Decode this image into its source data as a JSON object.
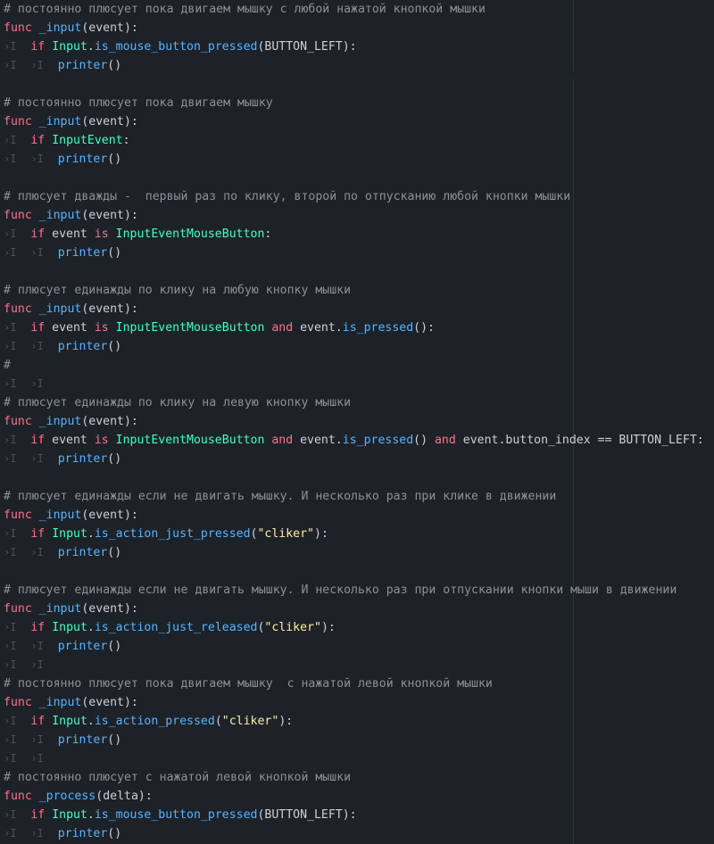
{
  "colors": {
    "background": "#1d2229",
    "comment": "#8c9097",
    "keyword": "#ff7085",
    "function": "#57b3ff",
    "type": "#42ffc2",
    "string": "#ffeda1",
    "text": "#cdcfd2",
    "tab_marker": "#4b5058"
  },
  "icons": {
    "tab_marker": "tab-indent-icon"
  },
  "lines": [
    [
      {
        "c": "cm",
        "t": "# постоянно плюсует пока двигаем мышку с любой нажатой кнопкой мышки"
      }
    ],
    [
      {
        "c": "kw",
        "t": "func"
      },
      {
        "c": "tx",
        "t": " "
      },
      {
        "c": "fn",
        "t": "_input"
      },
      {
        "c": "tx",
        "t": "(event):"
      }
    ],
    [
      {
        "c": "tab",
        "t": "›I"
      },
      {
        "c": "tx",
        "t": "  "
      },
      {
        "c": "kw",
        "t": "if"
      },
      {
        "c": "tx",
        "t": " "
      },
      {
        "c": "ty",
        "t": "Input"
      },
      {
        "c": "tx",
        "t": "."
      },
      {
        "c": "fn",
        "t": "is_mouse_button_pressed"
      },
      {
        "c": "tx",
        "t": "(BUTTON_LEFT):"
      }
    ],
    [
      {
        "c": "tab",
        "t": "›I"
      },
      {
        "c": "tx",
        "t": "  "
      },
      {
        "c": "tab",
        "t": "›I"
      },
      {
        "c": "tx",
        "t": "  "
      },
      {
        "c": "fn",
        "t": "printer"
      },
      {
        "c": "tx",
        "t": "()"
      }
    ],
    [],
    [
      {
        "c": "cm",
        "t": "# постоянно плюсует пока двигаем мышку"
      }
    ],
    [
      {
        "c": "kw",
        "t": "func"
      },
      {
        "c": "tx",
        "t": " "
      },
      {
        "c": "fn",
        "t": "_input"
      },
      {
        "c": "tx",
        "t": "(event):"
      }
    ],
    [
      {
        "c": "tab",
        "t": "›I"
      },
      {
        "c": "tx",
        "t": "  "
      },
      {
        "c": "kw",
        "t": "if"
      },
      {
        "c": "tx",
        "t": " "
      },
      {
        "c": "ty",
        "t": "InputEvent"
      },
      {
        "c": "tx",
        "t": ":"
      }
    ],
    [
      {
        "c": "tab",
        "t": "›I"
      },
      {
        "c": "tx",
        "t": "  "
      },
      {
        "c": "tab",
        "t": "›I"
      },
      {
        "c": "tx",
        "t": "  "
      },
      {
        "c": "fn",
        "t": "printer"
      },
      {
        "c": "tx",
        "t": "()"
      }
    ],
    [],
    [
      {
        "c": "cm",
        "t": "# плюсует дважды -  первый раз по клику, второй по отпусканию любой кнопки мышки"
      }
    ],
    [
      {
        "c": "kw",
        "t": "func"
      },
      {
        "c": "tx",
        "t": " "
      },
      {
        "c": "fn",
        "t": "_input"
      },
      {
        "c": "tx",
        "t": "(event):"
      }
    ],
    [
      {
        "c": "tab",
        "t": "›I"
      },
      {
        "c": "tx",
        "t": "  "
      },
      {
        "c": "kw",
        "t": "if"
      },
      {
        "c": "tx",
        "t": " event "
      },
      {
        "c": "kw",
        "t": "is"
      },
      {
        "c": "tx",
        "t": " "
      },
      {
        "c": "ty",
        "t": "InputEventMouseButton"
      },
      {
        "c": "tx",
        "t": ":"
      }
    ],
    [
      {
        "c": "tab",
        "t": "›I"
      },
      {
        "c": "tx",
        "t": "  "
      },
      {
        "c": "tab",
        "t": "›I"
      },
      {
        "c": "tx",
        "t": "  "
      },
      {
        "c": "fn",
        "t": "printer"
      },
      {
        "c": "tx",
        "t": "()"
      }
    ],
    [],
    [
      {
        "c": "cm",
        "t": "# плюсует единажды по клику на любую кнопку мышки"
      }
    ],
    [
      {
        "c": "kw",
        "t": "func"
      },
      {
        "c": "tx",
        "t": " "
      },
      {
        "c": "fn",
        "t": "_input"
      },
      {
        "c": "tx",
        "t": "(event):"
      }
    ],
    [
      {
        "c": "tab",
        "t": "›I"
      },
      {
        "c": "tx",
        "t": "  "
      },
      {
        "c": "kw",
        "t": "if"
      },
      {
        "c": "tx",
        "t": " event "
      },
      {
        "c": "kw",
        "t": "is"
      },
      {
        "c": "tx",
        "t": " "
      },
      {
        "c": "ty",
        "t": "InputEventMouseButton"
      },
      {
        "c": "tx",
        "t": " "
      },
      {
        "c": "kw",
        "t": "and"
      },
      {
        "c": "tx",
        "t": " event."
      },
      {
        "c": "fn",
        "t": "is_pressed"
      },
      {
        "c": "tx",
        "t": "():"
      }
    ],
    [
      {
        "c": "tab",
        "t": "›I"
      },
      {
        "c": "tx",
        "t": "  "
      },
      {
        "c": "tab",
        "t": "›I"
      },
      {
        "c": "tx",
        "t": "  "
      },
      {
        "c": "fn",
        "t": "printer"
      },
      {
        "c": "tx",
        "t": "()"
      }
    ],
    [
      {
        "c": "cm",
        "t": "#"
      }
    ],
    [
      {
        "c": "tab",
        "t": "›I"
      },
      {
        "c": "tx",
        "t": "  "
      },
      {
        "c": "tab",
        "t": "›I"
      }
    ],
    [
      {
        "c": "cm",
        "t": "# плюсует единажды по клику на левую кнопку мышки"
      }
    ],
    [
      {
        "c": "kw",
        "t": "func"
      },
      {
        "c": "tx",
        "t": " "
      },
      {
        "c": "fn",
        "t": "_input"
      },
      {
        "c": "tx",
        "t": "(event):"
      }
    ],
    [
      {
        "c": "tab",
        "t": "›I"
      },
      {
        "c": "tx",
        "t": "  "
      },
      {
        "c": "kw",
        "t": "if"
      },
      {
        "c": "tx",
        "t": " event "
      },
      {
        "c": "kw",
        "t": "is"
      },
      {
        "c": "tx",
        "t": " "
      },
      {
        "c": "ty",
        "t": "InputEventMouseButton"
      },
      {
        "c": "tx",
        "t": " "
      },
      {
        "c": "kw",
        "t": "and"
      },
      {
        "c": "tx",
        "t": " event."
      },
      {
        "c": "fn",
        "t": "is_pressed"
      },
      {
        "c": "tx",
        "t": "() "
      },
      {
        "c": "kw",
        "t": "and"
      },
      {
        "c": "tx",
        "t": " event.button_index == BUTTON_LEFT:"
      }
    ],
    [
      {
        "c": "tab",
        "t": "›I"
      },
      {
        "c": "tx",
        "t": "  "
      },
      {
        "c": "tab",
        "t": "›I"
      },
      {
        "c": "tx",
        "t": "  "
      },
      {
        "c": "fn",
        "t": "printer"
      },
      {
        "c": "tx",
        "t": "()"
      }
    ],
    [],
    [
      {
        "c": "cm",
        "t": "# плюсует единажды если не двигать мышку. И несколько раз при клике в движении"
      }
    ],
    [
      {
        "c": "kw",
        "t": "func"
      },
      {
        "c": "tx",
        "t": " "
      },
      {
        "c": "fn",
        "t": "_input"
      },
      {
        "c": "tx",
        "t": "(event):"
      }
    ],
    [
      {
        "c": "tab",
        "t": "›I"
      },
      {
        "c": "tx",
        "t": "  "
      },
      {
        "c": "kw",
        "t": "if"
      },
      {
        "c": "tx",
        "t": " "
      },
      {
        "c": "ty",
        "t": "Input"
      },
      {
        "c": "tx",
        "t": "."
      },
      {
        "c": "fn",
        "t": "is_action_just_pressed"
      },
      {
        "c": "tx",
        "t": "("
      },
      {
        "c": "st",
        "t": "\"cliker\""
      },
      {
        "c": "tx",
        "t": "):"
      }
    ],
    [
      {
        "c": "tab",
        "t": "›I"
      },
      {
        "c": "tx",
        "t": "  "
      },
      {
        "c": "tab",
        "t": "›I"
      },
      {
        "c": "tx",
        "t": "  "
      },
      {
        "c": "fn",
        "t": "printer"
      },
      {
        "c": "tx",
        "t": "()"
      }
    ],
    [],
    [
      {
        "c": "cm",
        "t": "# плюсует единажды если не двигать мышку. И несколько раз при отпускании кнопки мыши в движении"
      }
    ],
    [
      {
        "c": "kw",
        "t": "func"
      },
      {
        "c": "tx",
        "t": " "
      },
      {
        "c": "fn",
        "t": "_input"
      },
      {
        "c": "tx",
        "t": "(event):"
      }
    ],
    [
      {
        "c": "tab",
        "t": "›I"
      },
      {
        "c": "tx",
        "t": "  "
      },
      {
        "c": "kw",
        "t": "if"
      },
      {
        "c": "tx",
        "t": " "
      },
      {
        "c": "ty",
        "t": "Input"
      },
      {
        "c": "tx",
        "t": "."
      },
      {
        "c": "fn",
        "t": "is_action_just_released"
      },
      {
        "c": "tx",
        "t": "("
      },
      {
        "c": "st",
        "t": "\"cliker\""
      },
      {
        "c": "tx",
        "t": "):"
      }
    ],
    [
      {
        "c": "tab",
        "t": "›I"
      },
      {
        "c": "tx",
        "t": "  "
      },
      {
        "c": "tab",
        "t": "›I"
      },
      {
        "c": "tx",
        "t": "  "
      },
      {
        "c": "fn",
        "t": "printer"
      },
      {
        "c": "tx",
        "t": "()"
      }
    ],
    [
      {
        "c": "tab",
        "t": "›I"
      },
      {
        "c": "tx",
        "t": "  "
      },
      {
        "c": "tab",
        "t": "›I"
      }
    ],
    [
      {
        "c": "cm",
        "t": "# постоянно плюсует пока двигаем мышку  с нажатой левой кнопкой мышки"
      }
    ],
    [
      {
        "c": "kw",
        "t": "func"
      },
      {
        "c": "tx",
        "t": " "
      },
      {
        "c": "fn",
        "t": "_input"
      },
      {
        "c": "tx",
        "t": "(event):"
      }
    ],
    [
      {
        "c": "tab",
        "t": "›I"
      },
      {
        "c": "tx",
        "t": "  "
      },
      {
        "c": "kw",
        "t": "if"
      },
      {
        "c": "tx",
        "t": " "
      },
      {
        "c": "ty",
        "t": "Input"
      },
      {
        "c": "tx",
        "t": "."
      },
      {
        "c": "fn",
        "t": "is_action_pressed"
      },
      {
        "c": "tx",
        "t": "("
      },
      {
        "c": "st",
        "t": "\"cliker\""
      },
      {
        "c": "tx",
        "t": "):"
      }
    ],
    [
      {
        "c": "tab",
        "t": "›I"
      },
      {
        "c": "tx",
        "t": "  "
      },
      {
        "c": "tab",
        "t": "›I"
      },
      {
        "c": "tx",
        "t": "  "
      },
      {
        "c": "fn",
        "t": "printer"
      },
      {
        "c": "tx",
        "t": "()"
      }
    ],
    [
      {
        "c": "tab",
        "t": "›I"
      },
      {
        "c": "tx",
        "t": "  "
      },
      {
        "c": "tab",
        "t": "›I"
      }
    ],
    [
      {
        "c": "cm",
        "t": "# постоянно плюсует с нажатой левой кнопкой мышки"
      }
    ],
    [
      {
        "c": "kw",
        "t": "func"
      },
      {
        "c": "tx",
        "t": " "
      },
      {
        "c": "fn",
        "t": "_process"
      },
      {
        "c": "tx",
        "t": "(delta):"
      }
    ],
    [
      {
        "c": "tab",
        "t": "›I"
      },
      {
        "c": "tx",
        "t": "  "
      },
      {
        "c": "kw",
        "t": "if"
      },
      {
        "c": "tx",
        "t": " "
      },
      {
        "c": "ty",
        "t": "Input"
      },
      {
        "c": "tx",
        "t": "."
      },
      {
        "c": "fn",
        "t": "is_mouse_button_pressed"
      },
      {
        "c": "tx",
        "t": "(BUTTON_LEFT):"
      }
    ],
    [
      {
        "c": "tab",
        "t": "›I"
      },
      {
        "c": "tx",
        "t": "  "
      },
      {
        "c": "tab",
        "t": "›I"
      },
      {
        "c": "tx",
        "t": "  "
      },
      {
        "c": "fn",
        "t": "printer"
      },
      {
        "c": "tx",
        "t": "()"
      }
    ]
  ]
}
